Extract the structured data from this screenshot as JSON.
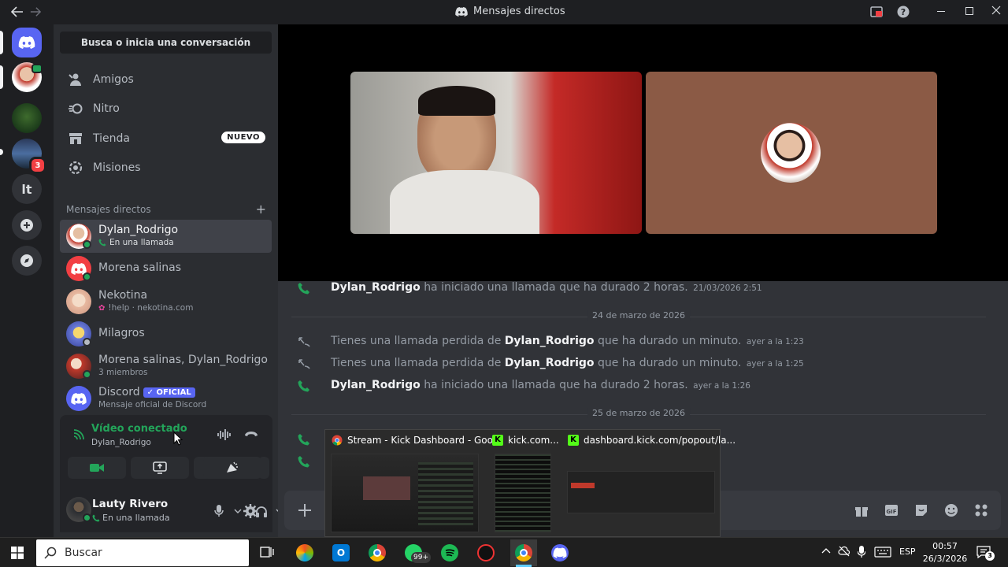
{
  "window": {
    "title": "Mensajes directos"
  },
  "sidebar": {
    "search_label": "Busca o inicia una conversación",
    "nav": [
      {
        "label": "Amigos",
        "icon": "friends-icon"
      },
      {
        "label": "Nitro",
        "icon": "nitro-icon"
      },
      {
        "label": "Tienda",
        "icon": "shop-icon",
        "badge": "NUEVO"
      },
      {
        "label": "Misiones",
        "icon": "quests-icon"
      }
    ],
    "dm_header": "Mensajes directos",
    "dms": [
      {
        "name": "Dylan_Rodrigo",
        "sub": "En una llamada"
      },
      {
        "name": "Morena salinas",
        "sub": ""
      },
      {
        "name": "Nekotina",
        "sub": "!help · nekotina.com"
      },
      {
        "name": "Milagros",
        "sub": ""
      },
      {
        "name": "Morena salinas, Dylan_Rodrigo",
        "sub": "3 miembros"
      },
      {
        "name": "Discord",
        "badge": "OFICIAL",
        "sub": "Mensaje oficial de Discord"
      }
    ]
  },
  "rail": {
    "badge_count": "3",
    "server_lt": "lt"
  },
  "voice": {
    "status": "Vídeo conectado",
    "channel": "Dylan_Rodrigo"
  },
  "user": {
    "name": "Lauty Rivero",
    "status": "En una llamada"
  },
  "messages": {
    "m1": {
      "user": "Dylan_Rodrigo",
      "text": "ha iniciado una llamada que ha durado 2 horas.",
      "time": "21/03/2026 2:51"
    },
    "date1": "24 de marzo de 2026",
    "m2": {
      "pre": "Tienes una llamada perdida de",
      "user": "Dylan_Rodrigo",
      "text": "que ha durado un minuto.",
      "time": "ayer a la 1:23"
    },
    "m3": {
      "pre": "Tienes una llamada perdida de",
      "user": "Dylan_Rodrigo",
      "text": "que ha durado un minuto.",
      "time": "ayer a la 1:25"
    },
    "m4": {
      "user": "Dylan_Rodrigo",
      "text": "ha iniciado una llamada que ha durado 2 horas.",
      "time": "ayer a la 1:26"
    },
    "date2": "25 de marzo de 2026"
  },
  "preview": {
    "tab1": "Stream - Kick Dashboard - Goo...",
    "tab2": "kick.com...",
    "tab3": "dashboard.kick.com/popout/la..."
  },
  "taskbar": {
    "search_placeholder": "Buscar",
    "lang": "ESP",
    "time": "00:57",
    "date": "26/3/2026",
    "whatsapp_badge": "99+"
  },
  "colors": {
    "accent": "#5865f2",
    "green": "#23a55a",
    "bg_main": "#313338",
    "bg_sidebar": "#2b2d31"
  }
}
